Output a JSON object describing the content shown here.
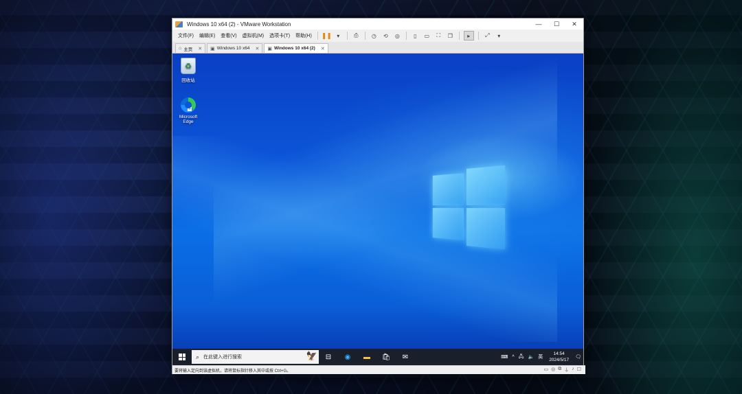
{
  "window": {
    "title": "Windows 10 x64 (2) - VMware Workstation",
    "minimize": "—",
    "maximize": "☐",
    "close": "✕"
  },
  "menu": [
    "文件(F)",
    "编辑(E)",
    "查看(V)",
    "虚拟机(M)",
    "选项卡(T)",
    "帮助(H)"
  ],
  "tabs": [
    {
      "label": "主页",
      "close": "✕"
    },
    {
      "label": "Windows 10 x64",
      "close": "✕"
    },
    {
      "label": "Windows 10 x64 (2)",
      "close": "✕"
    }
  ],
  "desktop": {
    "recycle_bin": "回收站",
    "edge_line1": "Microsoft",
    "edge_line2": "Edge"
  },
  "taskbar": {
    "search_placeholder": "在此键入进行搜索",
    "ime": "英",
    "time": "14:54",
    "date": "2024/5/17"
  },
  "status": {
    "hint": "要将输入定向到该虚拟机，请将鼠标指针移入其中或按 Ctrl+G。"
  },
  "colors": {
    "desktop_blue": "#0b55d8",
    "taskbar": "#1a1f2c",
    "pause_orange": "#e08a16"
  }
}
